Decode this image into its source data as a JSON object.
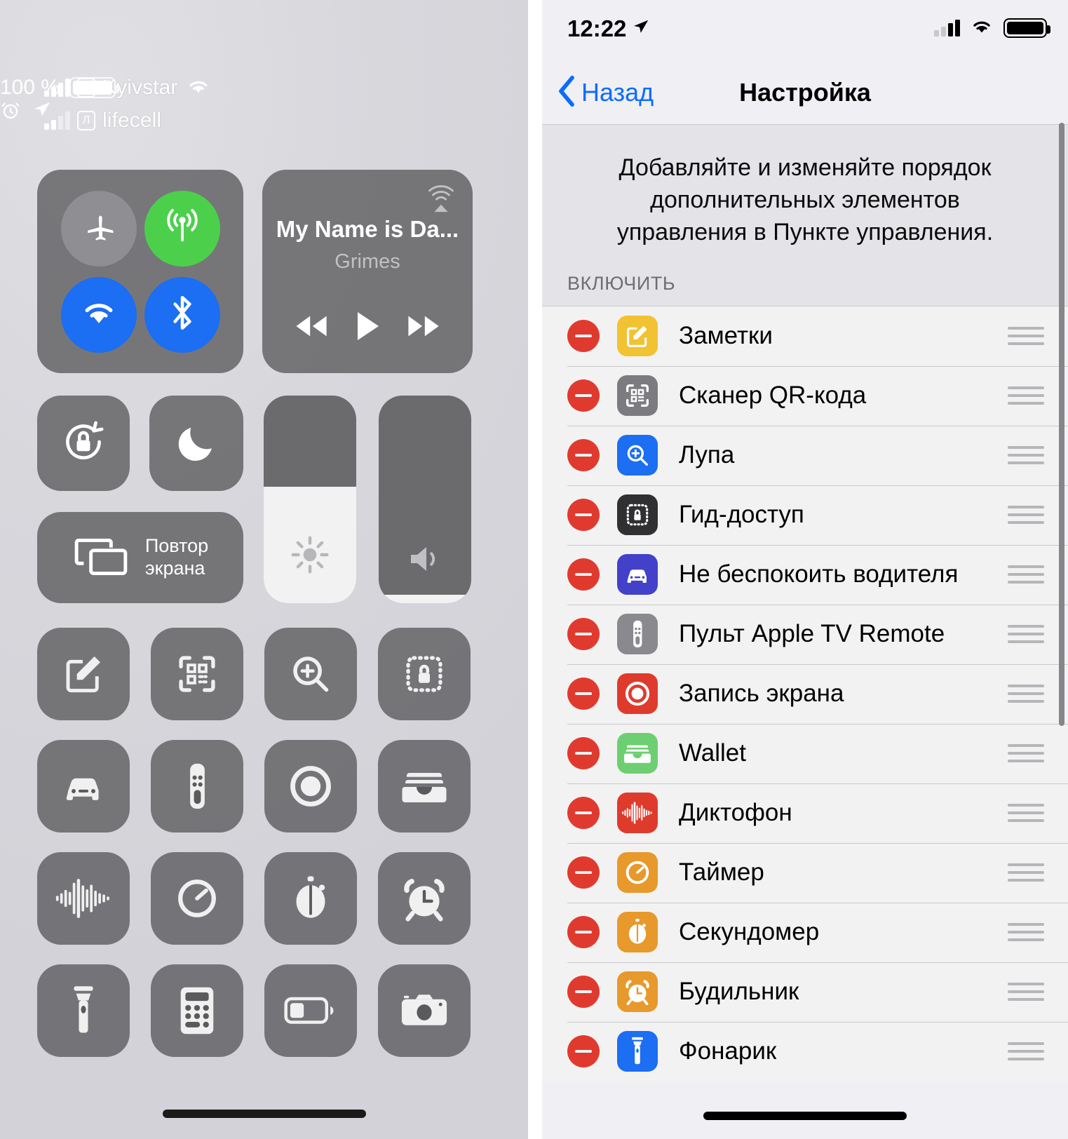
{
  "control_center": {
    "status_bar": {
      "carrier_primary": "Kyivstar",
      "carrier_primary_sim": "K",
      "carrier_secondary": "lifecell",
      "carrier_secondary_sim": "Л",
      "battery_percent": "100 %",
      "icons": [
        "signal-bars-icon",
        "sim-badge-icon",
        "wifi-icon",
        "battery-icon",
        "alarm-icon",
        "location-arrow-icon"
      ]
    },
    "toggles": [
      {
        "name": "airplane-mode",
        "icon": "airplane-icon",
        "state": "off",
        "color": "#8e8e93"
      },
      {
        "name": "cellular-data",
        "icon": "cellular-antenna-icon",
        "state": "on",
        "color": "#4cd04c"
      },
      {
        "name": "wifi",
        "icon": "wifi-icon",
        "state": "on",
        "color": "#1c6ef2"
      },
      {
        "name": "bluetooth",
        "icon": "bluetooth-icon",
        "state": "on",
        "color": "#1c6ef2"
      }
    ],
    "media": {
      "track_title": "My Name is Da...",
      "artist": "Grimes",
      "airplay_icon": "airplay-audio-icon",
      "controls": [
        "rewind-icon",
        "play-icon",
        "fast-forward-icon"
      ]
    },
    "quick": {
      "rotation_lock_icon": "rotation-lock-icon",
      "do_not_disturb_icon": "moon-icon",
      "screen_mirroring_label_line1": "Повтор",
      "screen_mirroring_label_line2": "экрана",
      "screen_mirroring_icon": "screen-mirroring-icon"
    },
    "sliders": {
      "brightness": {
        "icon": "brightness-sun-icon",
        "value_percent": 56
      },
      "volume": {
        "icon": "speaker-icon",
        "value_percent": 4
      }
    },
    "apps": [
      {
        "name": "notes",
        "icon": "notes-pencil-icon"
      },
      {
        "name": "qr-scanner",
        "icon": "qr-scanner-icon"
      },
      {
        "name": "magnifier",
        "icon": "magnifier-plus-icon"
      },
      {
        "name": "guided-access",
        "icon": "guided-access-lock-icon"
      },
      {
        "name": "do-not-disturb-while-driving",
        "icon": "car-icon"
      },
      {
        "name": "apple-tv-remote",
        "icon": "tv-remote-icon"
      },
      {
        "name": "screen-recording",
        "icon": "record-circle-icon"
      },
      {
        "name": "wallet",
        "icon": "wallet-icon"
      },
      {
        "name": "voice-memos",
        "icon": "waveform-icon"
      },
      {
        "name": "timer",
        "icon": "timer-icon"
      },
      {
        "name": "stopwatch",
        "icon": "stopwatch-icon"
      },
      {
        "name": "alarm",
        "icon": "alarm-clock-icon"
      },
      {
        "name": "flashlight",
        "icon": "flashlight-icon"
      },
      {
        "name": "calculator",
        "icon": "calculator-icon"
      },
      {
        "name": "low-power-mode",
        "icon": "battery-half-icon"
      },
      {
        "name": "camera",
        "icon": "camera-icon"
      }
    ]
  },
  "settings": {
    "status_bar": {
      "time": "12:22",
      "location_icon": "location-arrow-icon",
      "icons": [
        "signal-bars-icon",
        "wifi-icon",
        "battery-icon"
      ]
    },
    "nav": {
      "back_label": "Назад",
      "back_icon": "chevron-left-icon",
      "title": "Настройка"
    },
    "description": "Добавляйте и изменяйте порядок дополнительных элементов управления в Пункте управления.",
    "section_header": "ВКЛЮЧИТЬ",
    "items": [
      {
        "label": "Заметки",
        "icon": "notes-pencil-icon",
        "color": "#f1c232"
      },
      {
        "label": "Сканер QR-кода",
        "icon": "qr-scanner-icon",
        "color": "#7c7c80"
      },
      {
        "label": "Лупа",
        "icon": "magnifier-plus-icon",
        "color": "#1c6ef2"
      },
      {
        "label": "Гид-доступ",
        "icon": "guided-access-lock-icon",
        "color": "#303033"
      },
      {
        "label": "Не беспокоить водителя",
        "icon": "car-icon",
        "color": "#4341c9"
      },
      {
        "label": "Пульт Apple TV Remote",
        "icon": "tv-remote-icon",
        "color": "#8a8a8e"
      },
      {
        "label": "Запись экрана",
        "icon": "record-circle-icon",
        "color": "#df3b2d"
      },
      {
        "label": "Wallet",
        "icon": "wallet-icon",
        "color": "#6ecf72"
      },
      {
        "label": "Диктофон",
        "icon": "waveform-icon",
        "color": "#df3b2d"
      },
      {
        "label": "Таймер",
        "icon": "timer-icon",
        "color": "#e7992c"
      },
      {
        "label": "Секундомер",
        "icon": "stopwatch-icon",
        "color": "#e7992c"
      },
      {
        "label": "Будильник",
        "icon": "alarm-clock-icon",
        "color": "#e7992c"
      },
      {
        "label": "Фонарик",
        "icon": "flashlight-icon",
        "color": "#1c6ef2"
      }
    ],
    "remove_button_color": "#e03a2f",
    "accent_color": "#0a6cff"
  }
}
